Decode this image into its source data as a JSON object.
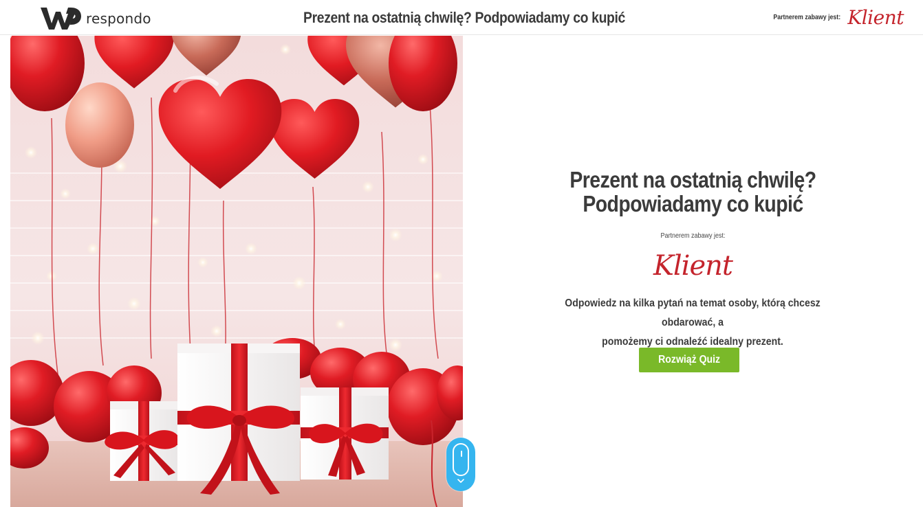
{
  "header": {
    "brand_name": "respondo",
    "title": "Prezent na ostatnią chwilę? Podpowiadamy co kupić",
    "partner_label": "Partnerem zabawy jest:",
    "partner_logo_text": "Klient"
  },
  "hero": {
    "image": "red heart balloons and white gift boxes with red ribbons"
  },
  "intro": {
    "title_line1": "Prezent na ostatnią chwilę?",
    "title_line2": "Podpowiadamy co kupić",
    "partner_label": "Partnerem zabawy jest:",
    "partner_logo_text": "Klient",
    "description_line1": "Odpowiedz na kilka pytań na temat osoby, którą chcesz obdarować, a",
    "description_line2": "pomożemy ci odnaleźć idealny prezent.",
    "button_label": "Rozwiąż Quiz"
  },
  "scroll_indicator": {
    "icon": "mouse-scroll-icon"
  },
  "colors": {
    "accent_green": "#7ab929",
    "brand_red": "#c4242c",
    "scroll_blue": "#35b5ef",
    "text_dark": "#3b3b3b"
  }
}
